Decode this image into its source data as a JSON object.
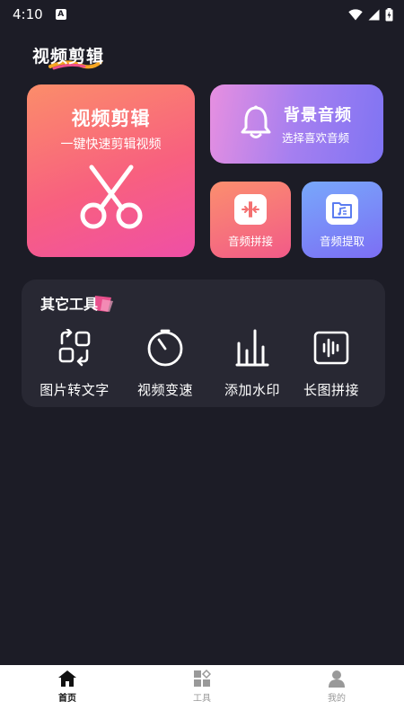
{
  "status_bar": {
    "time": "4:10",
    "notification_letter": "A"
  },
  "page": {
    "title": "视频剪辑"
  },
  "main_card": {
    "title": "视频剪辑",
    "subtitle": "一键快速剪辑视频",
    "icon": "scissors-icon"
  },
  "bgm_card": {
    "title": "背景音频",
    "subtitle": "选择喜欢音频",
    "icon": "bell-icon"
  },
  "small_cards": [
    {
      "label": "音频拼接",
      "icon": "audio-merge-icon"
    },
    {
      "label": "音频提取",
      "icon": "audio-extract-icon"
    }
  ],
  "other_tools": {
    "title": "其它工具",
    "items": [
      {
        "label": "图片转文字",
        "icon": "image-to-text-icon"
      },
      {
        "label": "视频变速",
        "icon": "speed-timer-icon"
      },
      {
        "label": "添加水印",
        "icon": "watermark-bars-icon"
      },
      {
        "label": "长图拼接",
        "icon": "long-image-icon"
      }
    ]
  },
  "bottom_nav": {
    "items": [
      {
        "label": "首页",
        "icon": "home-icon",
        "active": true
      },
      {
        "label": "工具",
        "icon": "tools-grid-icon",
        "active": false
      },
      {
        "label": "我的",
        "icon": "user-icon",
        "active": false
      }
    ]
  },
  "colors": {
    "background": "#1c1c26",
    "panel": "#282833",
    "main_card_gradient": [
      "#fb8d6a",
      "#ef4fa6"
    ],
    "bgm_card_gradient": [
      "#e78fe0",
      "#7f74f3"
    ],
    "concat_card_gradient": [
      "#fb8f6e",
      "#f25a88"
    ],
    "extract_card_gradient": [
      "#78a8fb",
      "#7c6ef4"
    ]
  }
}
